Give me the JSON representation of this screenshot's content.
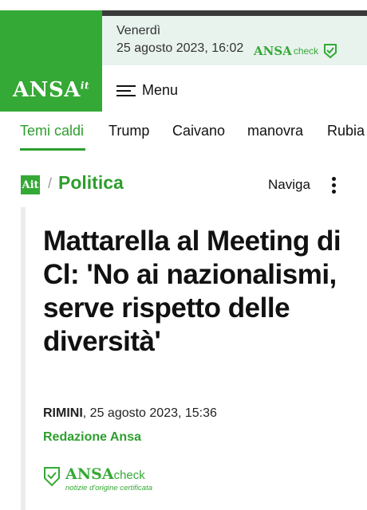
{
  "brand": {
    "logo_text": "ANSA",
    "logo_suffix": "it",
    "accent_color": "#35a935"
  },
  "header": {
    "day": "Venerdì",
    "datetime": "25 agosto 2023, 16:02",
    "check_ansa": "ANSA",
    "check_suffix": "check",
    "menu_label": "Menu"
  },
  "tags": [
    {
      "label": "Temi caldi",
      "active": true
    },
    {
      "label": "Trump"
    },
    {
      "label": "Caivano"
    },
    {
      "label": "manovra"
    },
    {
      "label": "Rubia"
    }
  ],
  "section": {
    "badge": "Ait",
    "separator": "/",
    "name": "Politica",
    "naviga_label": "Naviga"
  },
  "article": {
    "title": "Mattarella al Meeting di Cl: 'No ai nazionalismi, serve rispetto delle diversità'",
    "place": "RIMINI",
    "datetime": ", 25 agosto 2023, 15:36",
    "author": "Redazione Ansa"
  },
  "ansacheck_badge": {
    "ansa": "ANSA",
    "check": "check",
    "tagline": "notizie d'origine certificata"
  }
}
